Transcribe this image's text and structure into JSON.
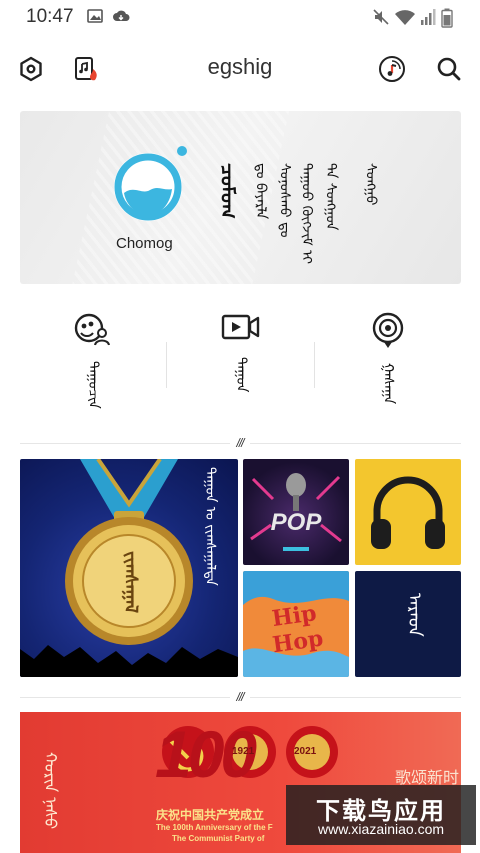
{
  "status_bar": {
    "time": "10:47",
    "icons": [
      "image-icon",
      "cloud-download-icon",
      "mute-icon",
      "wifi-icon",
      "signal-icon",
      "battery-icon"
    ]
  },
  "top_bar": {
    "title": "egshig",
    "icons": [
      "settings-icon",
      "hot-music-icon",
      "music-disc-icon",
      "search-icon"
    ]
  },
  "banner": {
    "logo_label": "Chomog",
    "vertical_texts": [
      "ᠴᠣᠮᠣᠭ",
      "ᠳᠤ ᠪᠠᠶᠠᠷᠯᠠ",
      "ᠰᠤᠨᠤᠰᠬᠤ ᠳᠤ",
      "ᠳᠠᠭᠤᠤ ᠬᠦᠭᠵᠢᠮ ᠢ",
      "ᠲᠠ ᠰᠣᠩᠭᠣᠨ",
      "ᠰᠣᠩᠭᠣ"
    ],
    "accent_color": "#3cb6e0"
  },
  "categories": [
    {
      "label": "ᠳᠠᠭᠤᠴᠢᠨ",
      "icon": "singers-icon"
    },
    {
      "label": "ᠳᠠᠭᠤᠨ",
      "icon": "video-icon"
    },
    {
      "label": "ᠭᠠᠰᠠᠭᠠ",
      "icon": "podcast-icon"
    }
  ],
  "section_mark": "///",
  "tiles": {
    "chart": {
      "title": "ᠳᠠᠭᠤᠨ ᠤ ᠵᠢᠭᠰᠠᠭᠠᠯᠲᠠ",
      "medal_text": "ᠵᠢᠭᠰᠠᠭᠠᠯ"
    },
    "pop": {
      "text": "POP"
    },
    "hiphop": {
      "text": "Hip Hop"
    },
    "folk": {
      "text": "ᠠᠷᠠᠳ"
    }
  },
  "red_banner": {
    "big_number": "100",
    "year_left": "1921",
    "year_right": "2021",
    "side_text": "歌颂新时",
    "cn_line": "庆祝中国共产党成立",
    "en_line1": "The 100th Anniversary of the F",
    "en_line2": "The Communist Party of",
    "mongolian_text": "ᠬᠣᠷᠢᠨ ᠨᠠᠰᠤ"
  },
  "watermark": {
    "text": "下载鸟应用",
    "url": "www.xiazainiao.com"
  }
}
